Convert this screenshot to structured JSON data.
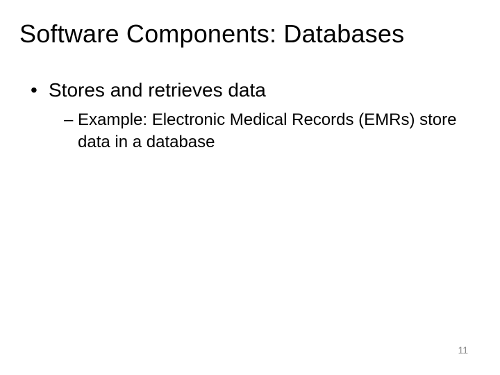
{
  "title": "Software Components: Databases",
  "bullets": [
    {
      "text": "Stores and retrieves data",
      "sub": [
        {
          "text": "Example: Electronic Medical Records (EMRs) store data in a database"
        }
      ]
    }
  ],
  "page_number": "11"
}
